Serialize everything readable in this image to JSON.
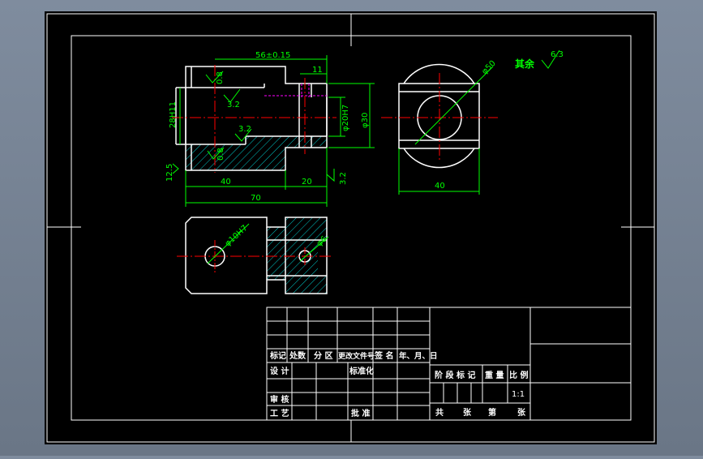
{
  "colors": {
    "background": "#000000",
    "frame": "#ffffff",
    "dimension": "#00ff00",
    "centerline": "#ff0000",
    "hatch": "#00c8c8",
    "hidden": "#ff00ff",
    "outer_bg": "#7f8c9e"
  },
  "dimensions": {
    "d_56": "56±0.15",
    "d_11": "11",
    "d_0_8a": "0.8",
    "d_3_2a": "3.2",
    "d_28h11": "28H11",
    "d_3_2b": "3.2",
    "d_phi20": "φ20H7",
    "d_phi30": "φ30",
    "d_0_8b": "0.8",
    "d_12_5": "12.5",
    "d_40a": "40",
    "d_20": "20",
    "d_3_2c": "3.2",
    "d_70": "70",
    "d_phi50": "φ50",
    "d_40b": "40",
    "d_phi10": "φ10H7",
    "d_phi6": "φ6",
    "rest_label": "其余",
    "rest_value": "6.3"
  },
  "title_block": {
    "headers": [
      "标记",
      "处数",
      "分 区",
      "更改文件号",
      "签 名",
      "年、月、日"
    ],
    "design": "设 计",
    "standardize": "标准化",
    "review": "审 核",
    "process": "工 艺",
    "approve": "批 准",
    "stage_mark": "阶 段 标 记",
    "weight": "重 量",
    "scale_label": "比 例",
    "scale_value": "1:1",
    "total": "共",
    "sheets": "张",
    "page": "第",
    "sheet2": "张"
  }
}
